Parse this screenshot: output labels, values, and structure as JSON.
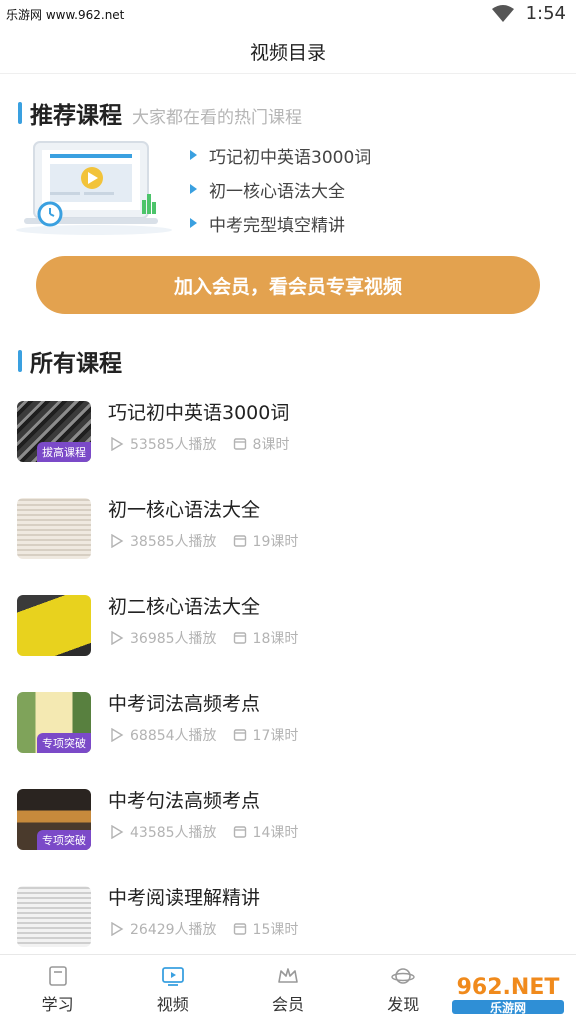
{
  "status_bar": {
    "watermark": "乐游网 www.962.net",
    "time": "1:54"
  },
  "header": {
    "title": "视频目录"
  },
  "recommend": {
    "title": "推荐课程",
    "subtitle": "大家都在看的热门课程",
    "items": [
      "巧记初中英语3000词",
      "初一核心语法大全",
      "中考完型填空精讲"
    ],
    "cta": "加入会员，看会员专享视频"
  },
  "all_courses": {
    "title": "所有课程",
    "courses": [
      {
        "title": "巧记初中英语3000词",
        "plays": "53585人播放",
        "lessons": "8课时",
        "badge": "拔高课程"
      },
      {
        "title": "初一核心语法大全",
        "plays": "38585人播放",
        "lessons": "19课时",
        "badge": ""
      },
      {
        "title": "初二核心语法大全",
        "plays": "36985人播放",
        "lessons": "18课时",
        "badge": ""
      },
      {
        "title": "中考词法高频考点",
        "plays": "68854人播放",
        "lessons": "17课时",
        "badge": "专项突破"
      },
      {
        "title": "中考句法高频考点",
        "plays": "43585人播放",
        "lessons": "14课时",
        "badge": "专项突破"
      },
      {
        "title": "中考阅读理解精讲",
        "plays": "26429人播放",
        "lessons": "15课时",
        "badge": ""
      }
    ]
  },
  "bottom_nav": {
    "items": [
      "学习",
      "视频",
      "会员",
      "发现"
    ]
  },
  "corner_logo": {
    "text": "962.NET",
    "subtext": "乐游网"
  },
  "colors": {
    "accent": "#3aa0e0",
    "cta": "#e3a24f",
    "badge": "#7b4ac8"
  }
}
